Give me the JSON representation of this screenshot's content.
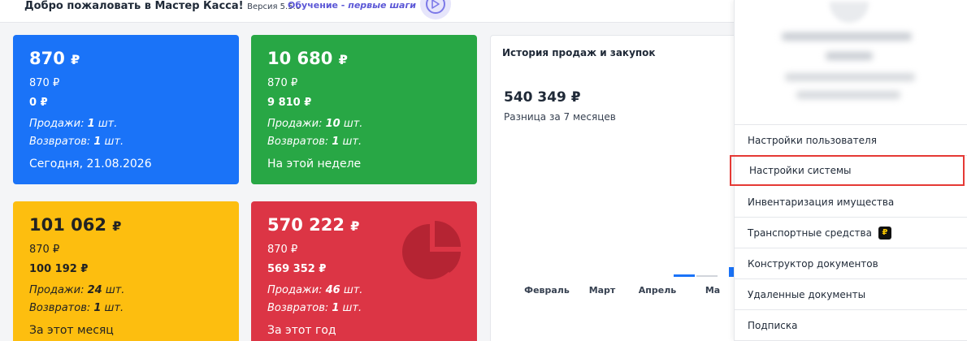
{
  "header": {
    "welcome": "Добро пожаловать в Мастер Касса!",
    "version": "Версия 5.5.0",
    "tutorial_prefix": "Обучение - ",
    "tutorial_emph": "первые шаги"
  },
  "cards": {
    "today": {
      "big": "870",
      "cur": "₽",
      "line1": "870 ₽",
      "line2": "0  ₽",
      "sales_prefix": "Продажи: ",
      "sales_count": "1",
      "sales_suffix": " шт.",
      "returns_prefix": "Возвратов: ",
      "returns_count": "1",
      "returns_suffix": " шт.",
      "period": "Сегодня, 21.08.2026"
    },
    "week": {
      "big": "10 680",
      "cur": "₽",
      "line1": "870 ₽",
      "line2": "9 810 ₽",
      "sales_prefix": "Продажи: ",
      "sales_count": "10",
      "sales_suffix": " шт.",
      "returns_prefix": "Возвратов: ",
      "returns_count": "1",
      "returns_suffix": " шт.",
      "period": "На этой неделе"
    },
    "month": {
      "big": "101 062",
      "cur": "₽",
      "line1": "870 ₽",
      "line2": "100 192 ₽",
      "sales_prefix": "Продажи: ",
      "sales_count": "24",
      "sales_suffix": " шт.",
      "returns_prefix": "Возвратов: ",
      "returns_count": "1",
      "returns_suffix": " шт.",
      "period": "За этот месяц"
    },
    "year": {
      "big": "570 222",
      "cur": "₽",
      "line1": "870 ₽",
      "line2": "569 352 ₽",
      "sales_prefix": "Продажи: ",
      "sales_count": "46",
      "sales_suffix": " шт.",
      "returns_prefix": "Возвратов: ",
      "returns_count": "1",
      "returns_suffix": " шт.",
      "period": "За этот год"
    }
  },
  "chart": {
    "title": "История продаж и закупок",
    "total": "540 349 ₽",
    "subtitle": "Разница за 7 месяцев",
    "month_labels": [
      "Февраль",
      "Март",
      "Апрель",
      "Ма"
    ]
  },
  "chart_data": {
    "type": "bar",
    "categories": [
      "Февраль",
      "Март",
      "Апрель",
      "Ма"
    ],
    "series": [
      {
        "values": [
          0,
          0,
          3,
          12
        ]
      },
      {
        "values": [
          0,
          0,
          2,
          0
        ]
      }
    ],
    "title": "История продаж и закупок",
    "colors": [
      "#1a73f8",
      "#d1d5db"
    ]
  },
  "menu": {
    "items": [
      "Настройки пользователя",
      "Настройки системы",
      "Инвентаризация имущества",
      "Транспортные средства",
      "Конструктор документов",
      "Удаленные документы",
      "Подписка"
    ],
    "badge": "₽"
  },
  "colors": {
    "blue": "#1a73f8",
    "green": "#28a745",
    "yellow": "#fdbe0f",
    "red": "#dc3545",
    "highlight": "#e53935",
    "tutorial": "#5b57d6"
  }
}
